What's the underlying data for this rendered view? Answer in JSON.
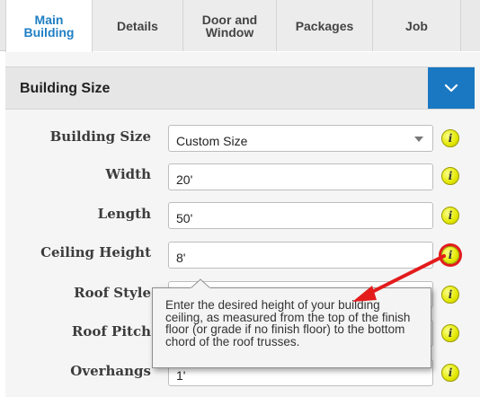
{
  "tabs": [
    {
      "label": "Main\nBuilding",
      "active": true
    },
    {
      "label": "Details",
      "active": false
    },
    {
      "label": "Door and\nWindow",
      "active": false
    },
    {
      "label": "Packages",
      "active": false
    },
    {
      "label": "Job",
      "active": false
    }
  ],
  "section": {
    "title": "Building Size",
    "toggle_icon": "chevron-down-icon"
  },
  "fields": {
    "building_size": {
      "label": "Building Size",
      "value": "Custom Size"
    },
    "width": {
      "label": "Width",
      "value": "20'"
    },
    "length": {
      "label": "Length",
      "value": "50'"
    },
    "ceiling_height": {
      "label": "Ceiling Height",
      "value": "8'"
    },
    "roof_style": {
      "label": "Roof Style"
    },
    "roof_pitch": {
      "label": "Roof Pitch"
    },
    "overhangs": {
      "label": "Overhangs",
      "value": "1'"
    }
  },
  "info_icon_glyph": "i",
  "tooltip": {
    "text": "Enter the desired height of your building ceiling, as measured from the top of the finish floor (or grade if no finish floor) to the bottom chord of the roof trusses."
  },
  "colors": {
    "accent": "#1a78c2",
    "active_tab_text": "#1f7fc4",
    "highlight": "#e31b1b",
    "info_yellow": "#e3e800"
  }
}
